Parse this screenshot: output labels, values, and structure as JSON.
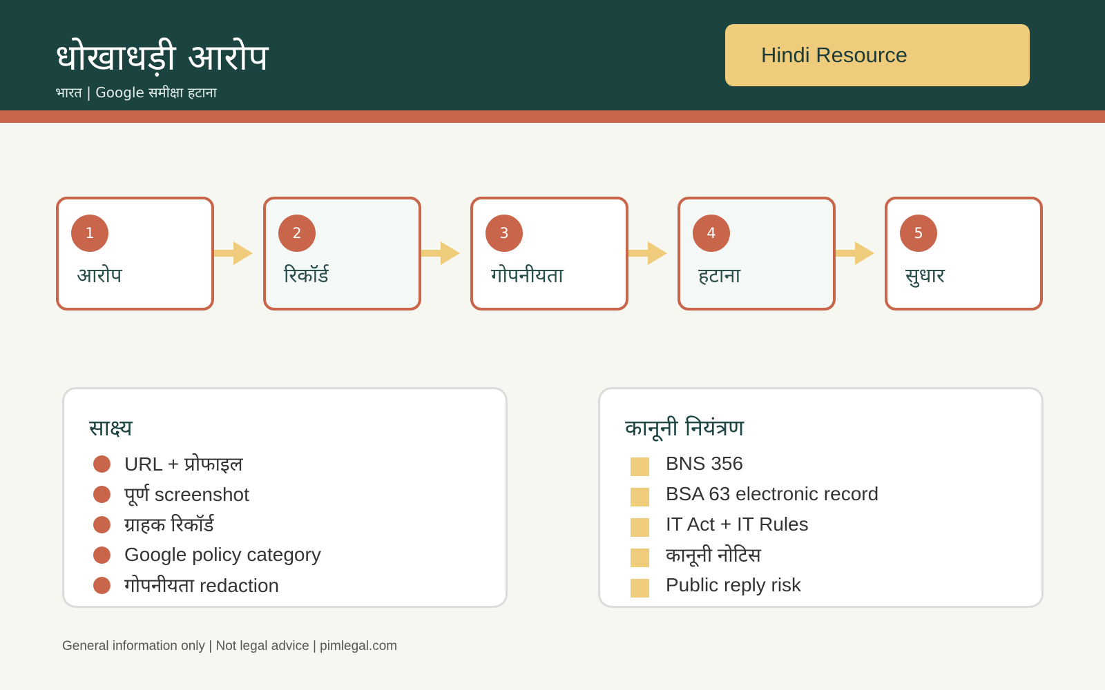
{
  "header": {
    "title": "धोखाधड़ी आरोप",
    "subtitle": "भारत | Google समीक्षा हटाना",
    "badge": "Hindi Resource"
  },
  "steps": [
    {
      "number": "1",
      "label": "आरोप"
    },
    {
      "number": "2",
      "label": "रिकॉर्ड"
    },
    {
      "number": "3",
      "label": "गोपनीयता"
    },
    {
      "number": "4",
      "label": "हटाना"
    },
    {
      "number": "5",
      "label": "सुधार"
    }
  ],
  "evidence": {
    "title": "साक्ष्य",
    "items": [
      "URL + प्रोफाइल",
      "पूर्ण screenshot",
      "ग्राहक रिकॉर्ड",
      "Google policy category",
      "गोपनीयता redaction"
    ]
  },
  "legal": {
    "title": "कानूनी नियंत्रण",
    "items": [
      "BNS 356",
      "BSA 63 electronic record",
      "IT Act + IT Rules",
      "कानूनी नोटिस",
      "Public reply risk"
    ]
  },
  "footer": "General information only | Not legal advice | pimlegal.com",
  "colors": {
    "header_bg": "#1b4340",
    "accent": "#c8654a",
    "highlight": "#efcc7c",
    "page_bg": "#f7f7f2"
  }
}
